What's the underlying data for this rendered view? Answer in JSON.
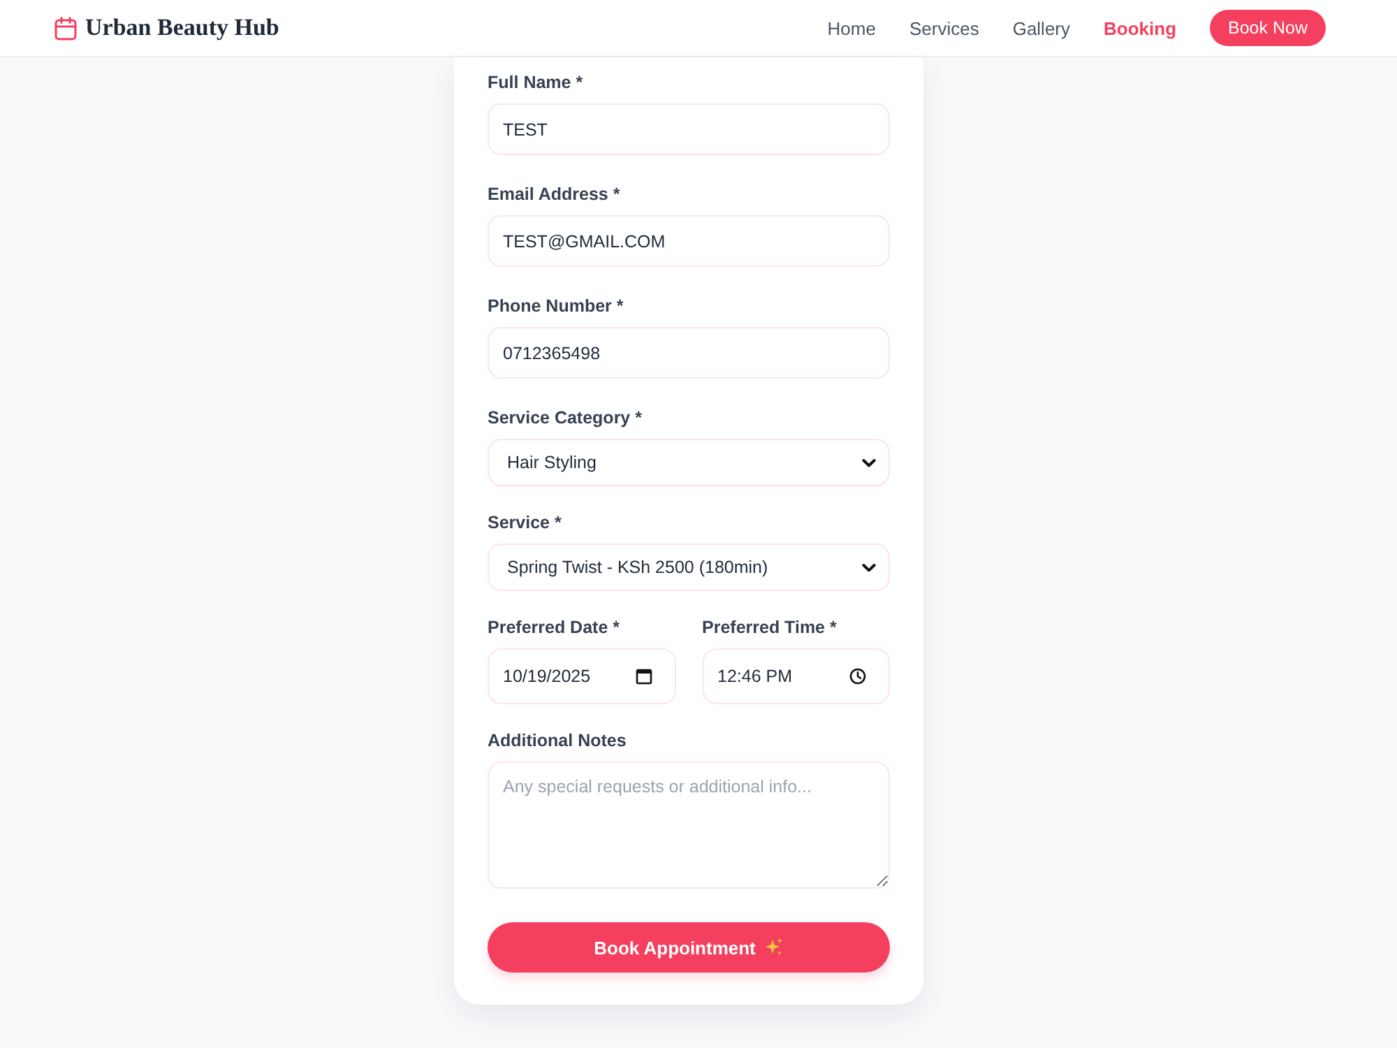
{
  "header": {
    "logo_text": "Urban Beauty Hub",
    "nav": [
      {
        "label": "Home",
        "selected": false
      },
      {
        "label": "Services",
        "selected": false
      },
      {
        "label": "Gallery",
        "selected": false
      },
      {
        "label": "Booking",
        "selected": true
      }
    ],
    "cta": "Book Now"
  },
  "form": {
    "fields": [
      {
        "kind": "text",
        "label": "Full Name *",
        "value": "TEST"
      },
      {
        "kind": "text",
        "label": "Email Address *",
        "value": "TEST@GMAIL.COM"
      },
      {
        "kind": "text",
        "label": "Phone Number *",
        "value": "0712365498"
      },
      {
        "kind": "select",
        "label": "Service Category *",
        "value": "Hair Styling"
      },
      {
        "kind": "select",
        "label": "Service *",
        "value": "Spring Twist - KSh 2500 (180min)"
      },
      {
        "kind": "row",
        "fields": [
          {
            "kind": "date",
            "label": "Preferred Date *",
            "value": "10/19/2025"
          },
          {
            "kind": "time",
            "label": "Preferred Time *",
            "value": "12:46 PM"
          }
        ]
      },
      {
        "kind": "textarea",
        "label": "Additional Notes",
        "placeholder": "Any special requests or additional info..."
      }
    ],
    "submit": "Book Appointment"
  }
}
